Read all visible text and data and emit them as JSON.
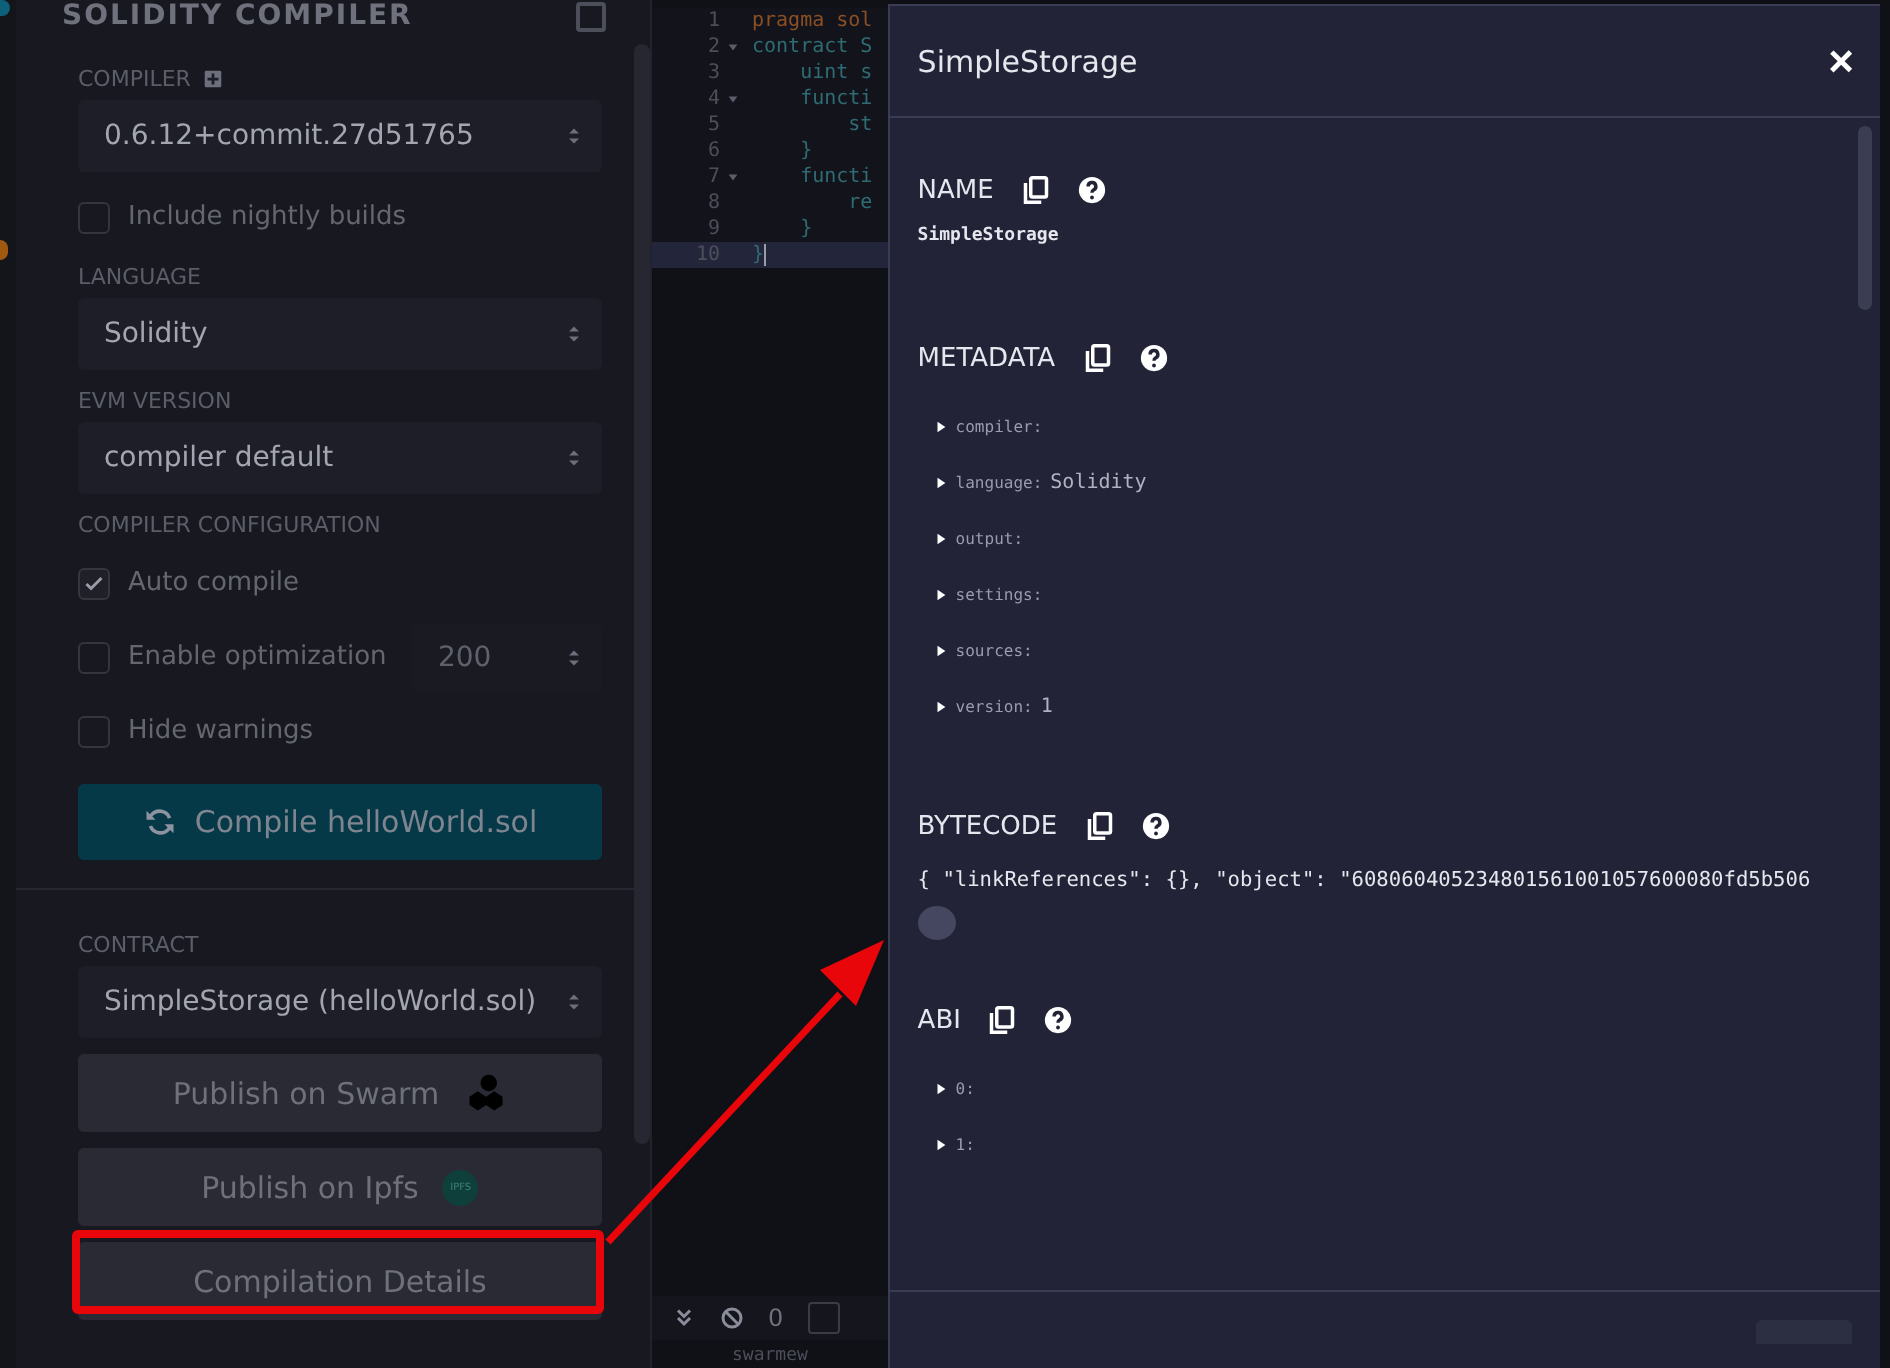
{
  "panel": {
    "title": "SOLIDITY COMPILER",
    "compiler": {
      "label": "COMPILER",
      "value": "0.6.12+commit.27d51765"
    },
    "nightly": {
      "label": "Include nightly builds",
      "checked": false
    },
    "language": {
      "label": "LANGUAGE",
      "value": "Solidity"
    },
    "evm": {
      "label": "EVM VERSION",
      "value": "compiler default"
    },
    "config": {
      "label": "COMPILER CONFIGURATION",
      "options": [
        {
          "label": "Auto compile",
          "checked": true
        },
        {
          "label": "Enable optimization",
          "checked": false,
          "runs": "200"
        },
        {
          "label": "Hide warnings",
          "checked": false
        }
      ]
    },
    "compile_button": "Compile helloWorld.sol",
    "contract": {
      "label": "CONTRACT",
      "value": "SimpleStorage (helloWorld.sol)"
    },
    "buttons": [
      {
        "label": "Publish on Swarm",
        "kind": "swarm",
        "highlighted": false
      },
      {
        "label": "Publish on Ipfs",
        "kind": "ipfs",
        "badge": "IPFS",
        "highlighted": false
      },
      {
        "label": "Compilation Details",
        "kind": "plain",
        "highlighted": true
      }
    ]
  },
  "editor": {
    "lines": [
      {
        "number": "1",
        "code": "pragma sol",
        "kind": "directive",
        "fold": false,
        "active": false
      },
      {
        "number": "2",
        "code": "contract S",
        "kind": "code",
        "fold": true,
        "active": false
      },
      {
        "number": "3",
        "code": "    uint s",
        "kind": "code",
        "fold": false,
        "active": false
      },
      {
        "number": "4",
        "code": "    functi",
        "kind": "code",
        "fold": true,
        "active": false
      },
      {
        "number": "5",
        "code": "        st",
        "kind": "code",
        "fold": false,
        "active": false
      },
      {
        "number": "6",
        "code": "    }",
        "kind": "code",
        "fold": false,
        "active": false
      },
      {
        "number": "7",
        "code": "    functi",
        "kind": "code",
        "fold": true,
        "active": false
      },
      {
        "number": "8",
        "code": "        re",
        "kind": "code",
        "fold": false,
        "active": false
      },
      {
        "number": "9",
        "code": "    }",
        "kind": "code",
        "fold": false,
        "active": false
      },
      {
        "number": "10",
        "code": "}",
        "kind": "code",
        "fold": false,
        "active": true
      }
    ],
    "terminal": {
      "count": "0",
      "checked": false,
      "log": "swarmew"
    }
  },
  "modal": {
    "title": "SimpleStorage",
    "close": "×",
    "sections": [
      {
        "heading": "NAME",
        "kind": "text",
        "value": "SimpleStorage"
      },
      {
        "heading": "METADATA",
        "kind": "tree",
        "items": [
          {
            "key": "compiler:"
          },
          {
            "key": "language:",
            "value": "Solidity"
          },
          {
            "key": "output:"
          },
          {
            "key": "settings:"
          },
          {
            "key": "sources:"
          },
          {
            "key": "version:",
            "value": "1"
          }
        ]
      },
      {
        "heading": "BYTECODE",
        "kind": "code",
        "value": "{ \"linkReferences\": {}, \"object\": \"608060405234801561001057600080fd5b506"
      },
      {
        "heading": "ABI",
        "kind": "tree",
        "items": [
          {
            "key": "0:"
          },
          {
            "key": "1:"
          }
        ]
      }
    ]
  },
  "annotation": {
    "arrow": true
  }
}
